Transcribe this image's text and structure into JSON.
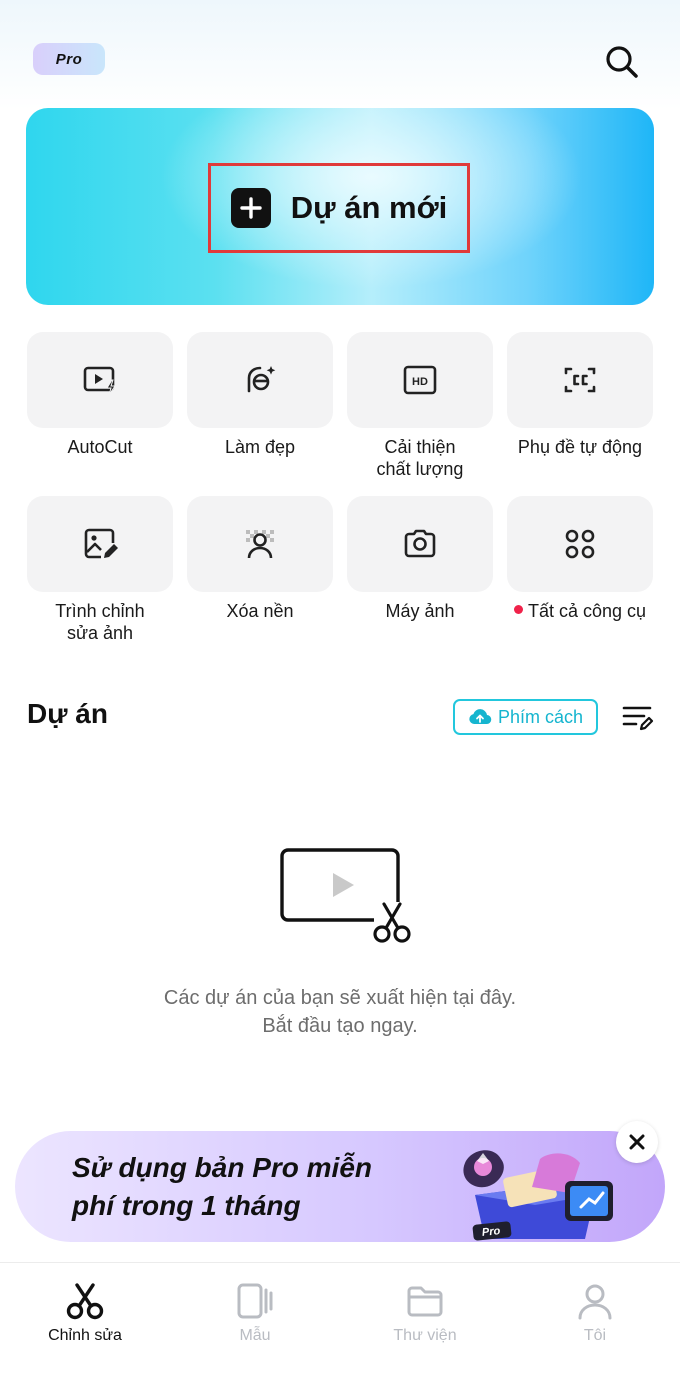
{
  "header": {
    "badge": "Pro"
  },
  "hero": {
    "new_project_label": "Dự án mới"
  },
  "tools": [
    {
      "label": "AutoCut",
      "icon": "autocut-icon"
    },
    {
      "label": "Làm đẹp",
      "icon": "beauty-icon"
    },
    {
      "label": "Cải thiện\nchất lượng",
      "icon": "hd-icon"
    },
    {
      "label": "Phụ đề tự động",
      "icon": "captions-icon"
    },
    {
      "label": "Trình chỉnh\nsửa ảnh",
      "icon": "photo-edit-icon"
    },
    {
      "label": "Xóa nền",
      "icon": "remove-bg-icon"
    },
    {
      "label": "Máy ảnh",
      "icon": "camera-icon"
    },
    {
      "label": "Tất cả công cụ",
      "icon": "all-tools-icon"
    }
  ],
  "projects": {
    "title": "Dự án",
    "cloud_button": "Phím cách",
    "empty_line1": "Các dự án của bạn sẽ xuất hiện tại đây.",
    "empty_line2": "Bắt đầu tạo ngay."
  },
  "promo": {
    "line1": "Sử dụng bản Pro miễn",
    "line2": "phí trong 1 tháng",
    "art_badge": "Pro"
  },
  "tabs": [
    {
      "label": "Chỉnh sửa",
      "active": true
    },
    {
      "label": "Mẫu",
      "active": false
    },
    {
      "label": "Thư viện",
      "active": false
    },
    {
      "label": "Tôi",
      "active": false
    }
  ],
  "colors": {
    "accent": "#22c7dd",
    "highlight_box": "#e03a3a",
    "notification_dot": "#f0224a"
  }
}
